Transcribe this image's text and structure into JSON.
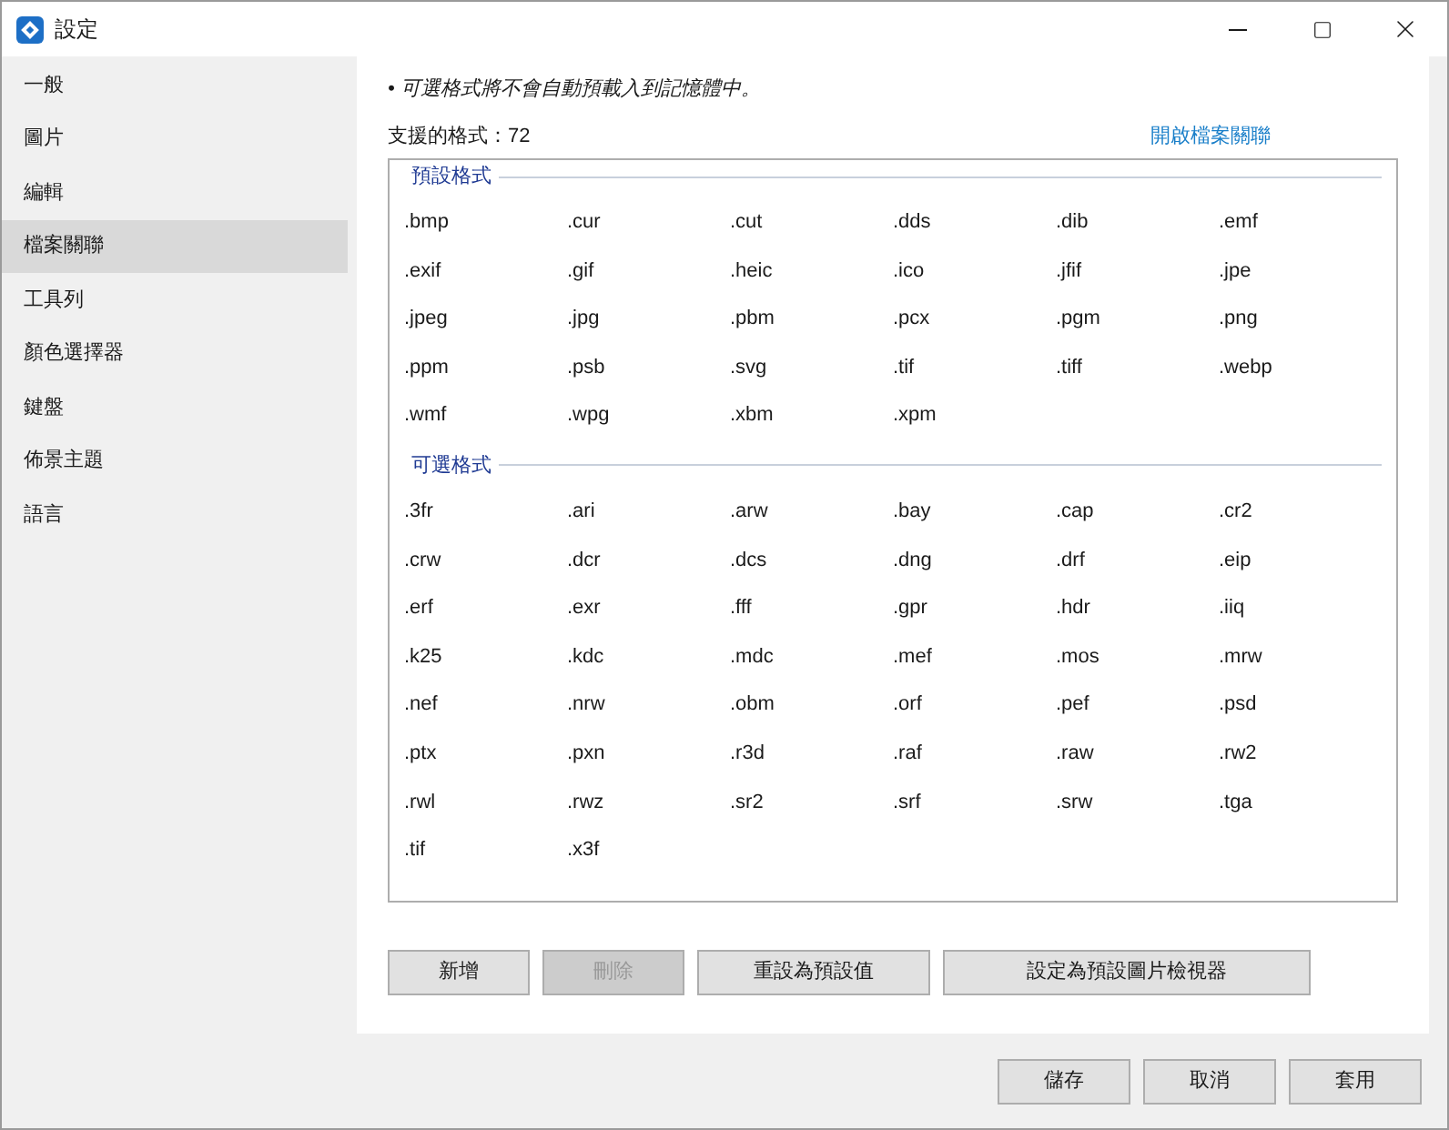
{
  "window": {
    "title": "設定"
  },
  "sidebar": {
    "items": [
      {
        "label": "一般",
        "selected": false
      },
      {
        "label": "圖片",
        "selected": false
      },
      {
        "label": "編輯",
        "selected": false
      },
      {
        "label": "檔案關聯",
        "selected": true
      },
      {
        "label": "工具列",
        "selected": false
      },
      {
        "label": "顏色選擇器",
        "selected": false
      },
      {
        "label": "鍵盤",
        "selected": false
      },
      {
        "label": "佈景主題",
        "selected": false
      },
      {
        "label": "語言",
        "selected": false
      }
    ]
  },
  "note": "• 可選格式將不會自動預載入到記憶體中。",
  "supported_count": "支援的格式：72",
  "open_association_link": "開啟檔案關聯",
  "format_groups": [
    {
      "label": "預設格式",
      "items": [
        ".bmp",
        ".cur",
        ".cut",
        ".dds",
        ".dib",
        ".emf",
        ".exif",
        ".gif",
        ".heic",
        ".ico",
        ".jfif",
        ".jpe",
        ".jpeg",
        ".jpg",
        ".pbm",
        ".pcx",
        ".pgm",
        ".png",
        ".ppm",
        ".psb",
        ".svg",
        ".tif",
        ".tiff",
        ".webp",
        ".wmf",
        ".wpg",
        ".xbm",
        ".xpm"
      ]
    },
    {
      "label": "可選格式",
      "items": [
        ".3fr",
        ".ari",
        ".arw",
        ".bay",
        ".cap",
        ".cr2",
        ".crw",
        ".dcr",
        ".dcs",
        ".dng",
        ".drf",
        ".eip",
        ".erf",
        ".exr",
        ".fff",
        ".gpr",
        ".hdr",
        ".iiq",
        ".k25",
        ".kdc",
        ".mdc",
        ".mef",
        ".mos",
        ".mrw",
        ".nef",
        ".nrw",
        ".obm",
        ".orf",
        ".pef",
        ".psd",
        ".ptx",
        ".pxn",
        ".r3d",
        ".raf",
        ".raw",
        ".rw2",
        ".rwl",
        ".rwz",
        ".sr2",
        ".srf",
        ".srw",
        ".tga",
        ".tif",
        ".x3f"
      ]
    }
  ],
  "panel_buttons": [
    {
      "label": "新增",
      "disabled": false
    },
    {
      "label": "刪除",
      "disabled": true
    },
    {
      "label": "重設為預設值",
      "disabled": false
    },
    {
      "label": "設定為預設圖片檢視器",
      "disabled": false
    }
  ],
  "footer_buttons": [
    {
      "label": "儲存",
      "disabled": false
    },
    {
      "label": "取消",
      "disabled": false
    },
    {
      "label": "套用",
      "disabled": false
    }
  ]
}
